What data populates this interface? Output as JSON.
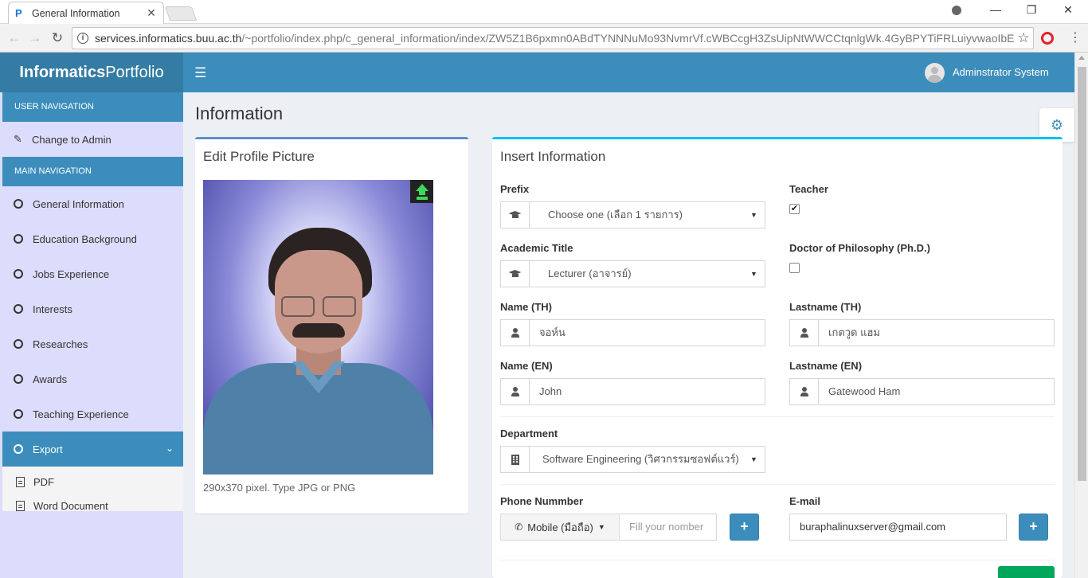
{
  "browser": {
    "tab_title": "General Information",
    "url_host": "services.informatics.buu.ac.th",
    "url_path": "/~portfolio/index.php/c_general_information/index/ZW5Z1B6pxmn0ABdTYNNNuMo93NvmrVf.cWBCcgH3ZsUipNtWWCCtqnlgWk.4GyBPYTiFRLuiyvwaoIbE..."
  },
  "header": {
    "logo_bold": "Informatics",
    "logo_light": "Portfolio",
    "user_name": "Adminstrator System"
  },
  "sidebar": {
    "user_nav_header": "USER NAVIGATION",
    "change_admin": "Change to Admin",
    "main_nav_header": "MAIN NAVIGATION",
    "items": [
      {
        "label": "General Information"
      },
      {
        "label": "Education Background"
      },
      {
        "label": "Jobs Experience"
      },
      {
        "label": "Interests"
      },
      {
        "label": "Researches"
      },
      {
        "label": "Awards"
      },
      {
        "label": "Teaching Experience"
      }
    ],
    "export": {
      "label": "Export",
      "sub": [
        {
          "label": "PDF"
        },
        {
          "label": "Word Document"
        }
      ]
    }
  },
  "page": {
    "title": "Information"
  },
  "profile_box": {
    "title": "Edit Profile Picture",
    "hint": "290x370 pixel. Type JPG or PNG"
  },
  "form": {
    "title": "Insert Information",
    "prefix_label": "Prefix",
    "prefix_value": "Choose one (เลือก 1 รายการ)",
    "teacher_label": "Teacher",
    "teacher_checked": true,
    "academic_label": "Academic Title",
    "academic_value": "Lecturer (อาจารย์)",
    "phd_label": "Doctor of Philosophy (Ph.D.)",
    "phd_checked": false,
    "name_th_label": "Name (TH)",
    "name_th_value": "จอห์น",
    "lastname_th_label": "Lastname (TH)",
    "lastname_th_value": "เกตวูด แฮม",
    "name_en_label": "Name (EN)",
    "name_en_value": "John",
    "lastname_en_label": "Lastname (EN)",
    "lastname_en_value": "Gatewood Ham",
    "department_label": "Department",
    "department_value": "Software Engineering (วิศวกรรมซอฟต์แวร์)",
    "phone_label": "Phone Nummber",
    "phone_type": "Mobile (มือถือ)",
    "phone_placeholder": "Fill your nomber",
    "email_label": "E-mail",
    "email_value": "buraphalinuxserver@gmail.com"
  },
  "colors": {
    "primary": "#3c8dbc",
    "logo_bg": "#357ca5",
    "sidebar_bg": "#dcdcfc",
    "success": "#00a65a"
  }
}
